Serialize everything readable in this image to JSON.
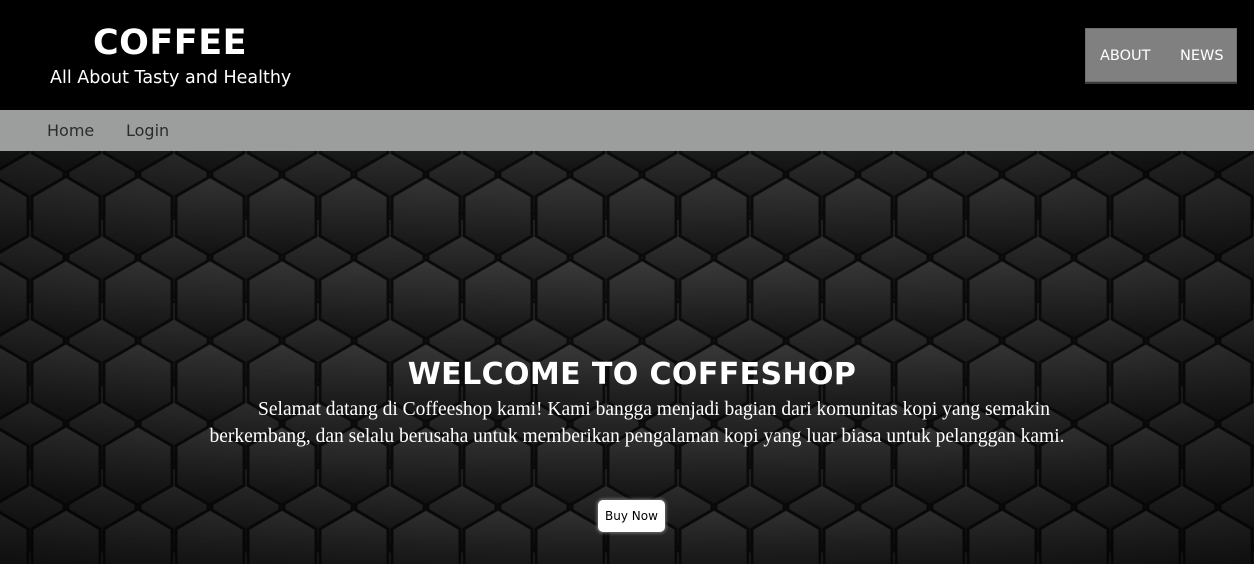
{
  "header": {
    "brand_title": "COFFEE",
    "brand_tagline": "All About Tasty and Healthy",
    "links": [
      "ABOUT",
      "NEWS"
    ]
  },
  "nav": {
    "items": [
      "Home",
      "Login"
    ]
  },
  "hero": {
    "title": "WELCOME TO COFFESHOP",
    "text": "Selamat datang di Coffeeshop kami! Kami bangga menjadi bagian dari komunitas kopi yang semakin berkembang, dan selalu berusaha untuk memberikan pengalaman kopi yang luar biasa untuk pelanggan kami.",
    "button_label": "Buy Now"
  },
  "colors": {
    "header_bg": "#000000",
    "nav_bg": "#9c9e9e",
    "top_links_bg": "#808080",
    "hero_bg": "#262626",
    "text_light": "#ffffff"
  },
  "icons": {
    "hero_background": "hexagon-pattern"
  }
}
